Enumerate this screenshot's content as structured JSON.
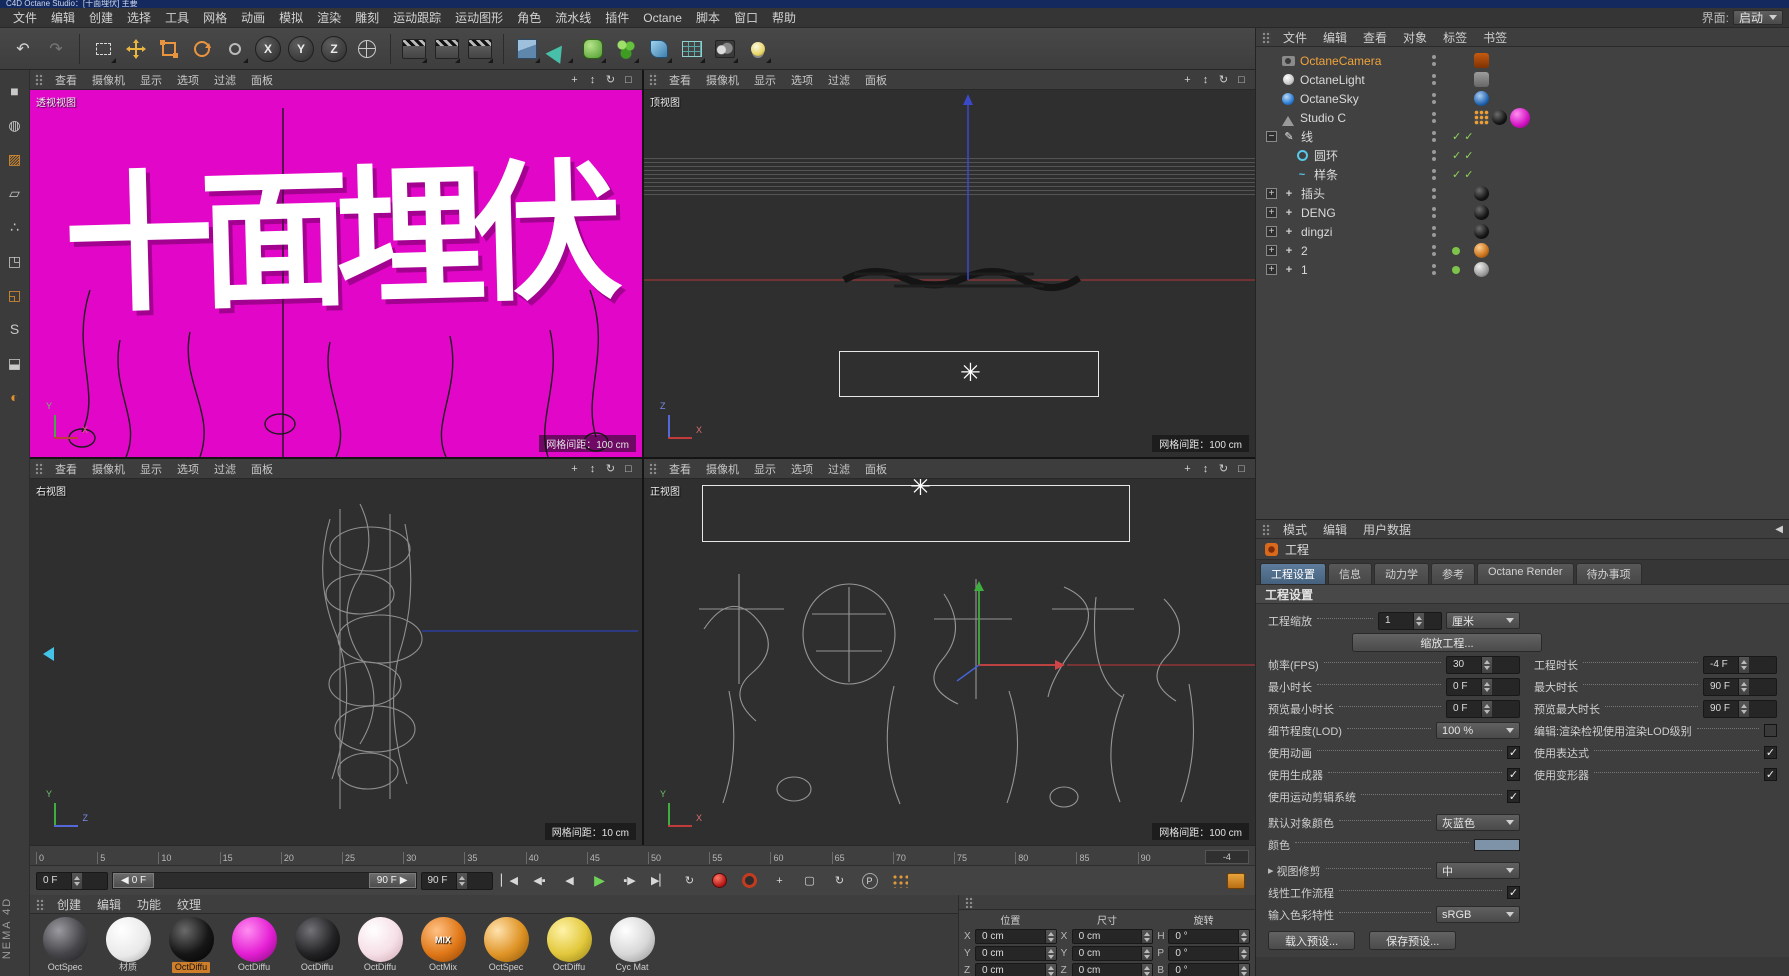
{
  "window": {
    "title": "C4D Octane Studio：[十面埋伏] 主要",
    "interface_label": "界面:",
    "interface_value": "启动"
  },
  "menubar": {
    "items": [
      "文件",
      "编辑",
      "创建",
      "选择",
      "工具",
      "网格",
      "动画",
      "模拟",
      "渲染",
      "雕刻",
      "运动跟踪",
      "运动图形",
      "角色",
      "流水线",
      "插件",
      "Octane",
      "脚本",
      "窗口",
      "帮助"
    ]
  },
  "toolbar": {
    "axes": [
      "X",
      "Y",
      "Z"
    ]
  },
  "viewport_menu": {
    "items": [
      "查看",
      "摄像机",
      "显示",
      "选项",
      "过滤",
      "面板"
    ]
  },
  "viewports": {
    "perspective": {
      "label": "透视视图",
      "grid_label": "网格间距：100 cm",
      "scene_text": "十面埋伏",
      "bg_color": "#e206c9",
      "axes": [
        "Y",
        "X"
      ]
    },
    "top": {
      "label": "顶视图",
      "grid_label": "网格间距：100 cm",
      "axes": [
        "Z",
        "X"
      ]
    },
    "right": {
      "label": "右视图",
      "grid_label": "网格间距：10 cm",
      "axes": [
        "Y",
        "Z"
      ]
    },
    "front": {
      "label": "正视图",
      "grid_label": "网格间距：100 cm",
      "axes": [
        "Y",
        "X"
      ]
    }
  },
  "timeline": {
    "ticks": [
      "0",
      "5",
      "10",
      "15",
      "20",
      "25",
      "30",
      "35",
      "40",
      "45",
      "50",
      "55",
      "60",
      "65",
      "70",
      "75",
      "80",
      "85",
      "90"
    ],
    "end_tick": "-4",
    "frame_field": "0 F",
    "slider_start": "0 F",
    "slider_end": "90 F",
    "duration_field": "90 F"
  },
  "materials": {
    "menu": [
      "创建",
      "编辑",
      "功能",
      "纹理"
    ],
    "selected_index": 2,
    "items": [
      {
        "name": "OctSpec",
        "color": "#46464a"
      },
      {
        "name": "材质",
        "color": "#f2f2f2"
      },
      {
        "name": "OctDiffu",
        "color": "#161616"
      },
      {
        "name": "OctDiffu",
        "color": "#e41fd4"
      },
      {
        "name": "OctDiffu",
        "color": "#232325"
      },
      {
        "name": "OctDiffu",
        "color": "#f6dfe6"
      },
      {
        "name": "OctMix",
        "color": "#e07818",
        "overlay": "MIX"
      },
      {
        "name": "OctSpec",
        "color": "#df9426"
      },
      {
        "name": "OctDiffu",
        "color": "#e2c83c"
      },
      {
        "name": "Cyc Mat",
        "color": "#d8d8d8"
      }
    ]
  },
  "coordinates": {
    "groups": [
      {
        "title": "位置",
        "rows": [
          {
            "axis": "X",
            "value": "0 cm"
          },
          {
            "axis": "Y",
            "value": "0 cm"
          },
          {
            "axis": "Z",
            "value": "0 cm"
          }
        ]
      },
      {
        "title": "尺寸",
        "rows": [
          {
            "axis": "X",
            "value": "0 cm"
          },
          {
            "axis": "Y",
            "value": "0 cm"
          },
          {
            "axis": "Z",
            "value": "0 cm"
          }
        ]
      },
      {
        "title": "旋转",
        "rows": [
          {
            "axis": "H",
            "value": "0 °"
          },
          {
            "axis": "P",
            "value": "0 °"
          },
          {
            "axis": "B",
            "value": "0 °"
          }
        ]
      }
    ]
  },
  "object_manager": {
    "menu": [
      "文件",
      "编辑",
      "查看",
      "对象",
      "标签",
      "书签"
    ],
    "items": [
      {
        "name": "OctaneCamera"
      },
      {
        "name": "OctaneLight"
      },
      {
        "name": "OctaneSky"
      },
      {
        "name": "Studio C"
      },
      {
        "name": "线"
      },
      {
        "name": "圆环"
      },
      {
        "name": "样条"
      },
      {
        "name": "插头"
      },
      {
        "name": "DENG"
      },
      {
        "name": "dingzi"
      },
      {
        "name": "2"
      },
      {
        "name": "1"
      }
    ]
  },
  "attributes": {
    "menu": [
      "模式",
      "编辑",
      "用户数据"
    ],
    "panel_title": "工程",
    "tabs": [
      "工程设置",
      "信息",
      "动力学",
      "参考",
      "Octane Render",
      "待办事项"
    ],
    "active_tab": "工程设置",
    "section_title": "工程设置",
    "fields": {
      "scale_label": "工程缩放",
      "scale_value": "1",
      "scale_unit": "厘米",
      "scale_button": "缩放工程...",
      "fps_label": "帧率(FPS)",
      "fps_value": "30",
      "length_label": "工程时长",
      "length_value": "-4 F",
      "min_label": "最小时长",
      "min_value": "0 F",
      "max_label": "最大时长",
      "max_value": "90 F",
      "pmin_label": "预览最小时长",
      "pmin_value": "0 F",
      "pmax_label": "预览最大时长",
      "pmax_value": "90 F",
      "lod_label": "细节程度(LOD)",
      "lod_value": "100 %",
      "lod_editor_label": "编辑:渲染检视使用渲染LOD级别",
      "use_anim_label": "使用动画",
      "use_expr_label": "使用表达式",
      "use_gen_label": "使用生成器",
      "use_def_label": "使用变形器",
      "use_motion_label": "使用运动剪辑系统",
      "default_color_label": "默认对象颜色",
      "default_color_value": "灰蓝色",
      "color_label": "颜色",
      "color_swatch": "#7f93a8",
      "view_clip_label": "视图修剪",
      "view_clip_value": "中",
      "linear_label": "线性工作流程",
      "input_color_label": "输入色彩特性",
      "input_color_value": "sRGB",
      "load_preset": "载入预设...",
      "save_preset": "保存预设..."
    }
  },
  "branding": {
    "watermark": "NEMA 4D"
  }
}
